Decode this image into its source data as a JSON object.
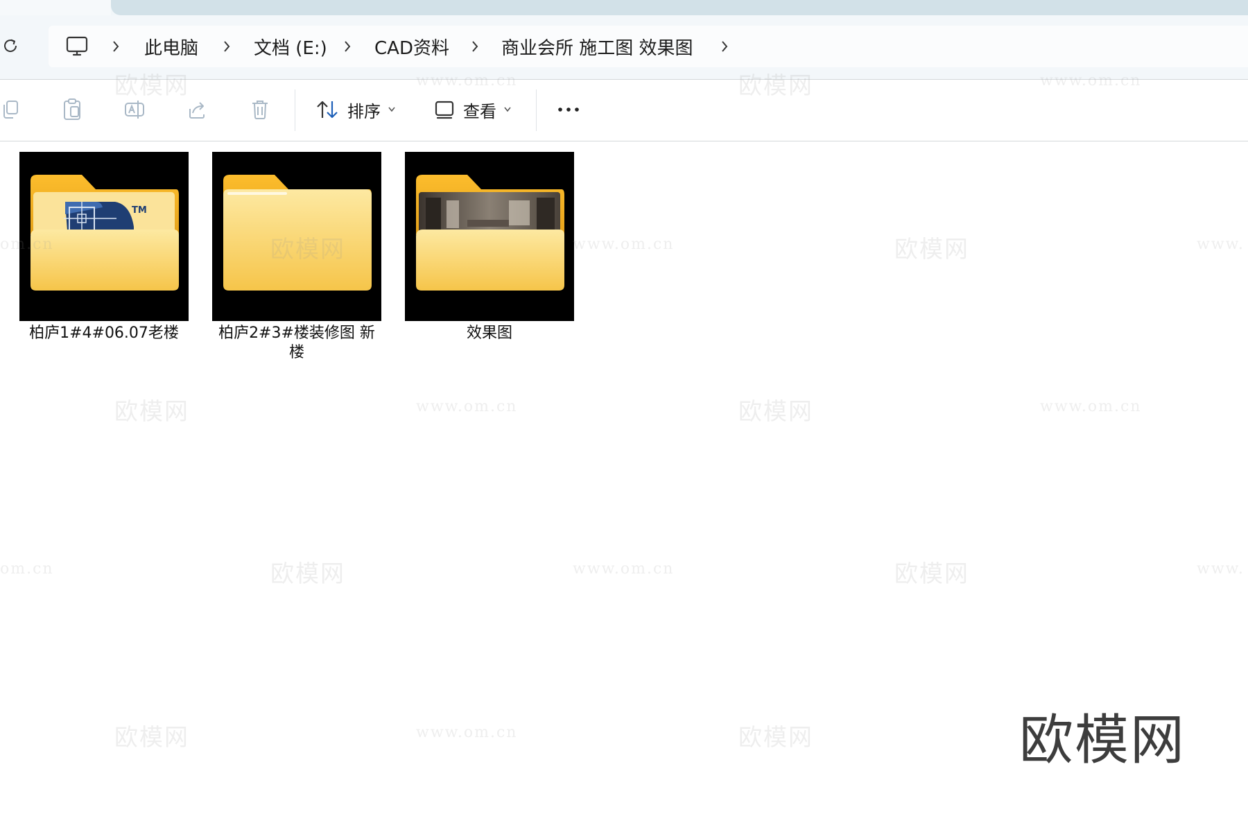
{
  "breadcrumb": {
    "items": [
      "此电脑",
      "文档 (E:)",
      "CAD资料",
      "商业会所 施工图 效果图"
    ]
  },
  "toolbar": {
    "sort_label": "排序",
    "view_label": "查看"
  },
  "files": [
    {
      "name": "柏庐1#4#06.07老楼",
      "thumb": "cad-folder"
    },
    {
      "name": "柏庐2#3#楼装修图  新楼",
      "thumb": "empty-folder"
    },
    {
      "name": "效果图",
      "thumb": "render-folder"
    }
  ],
  "watermark": {
    "logo": "欧模网",
    "url": "www.om.cn",
    "url_partial": "om.cn",
    "url_partial_right": "www.",
    "color": "#3d3d3d"
  },
  "icons": {
    "refresh": "refresh-icon",
    "computer": "monitor-icon",
    "copy": "copy-icon",
    "paste": "paste-icon",
    "rename": "rename-icon",
    "share": "share-icon",
    "delete": "delete-icon",
    "sort": "sort-arrows-icon",
    "view": "view-icon",
    "more": "more-icon"
  }
}
